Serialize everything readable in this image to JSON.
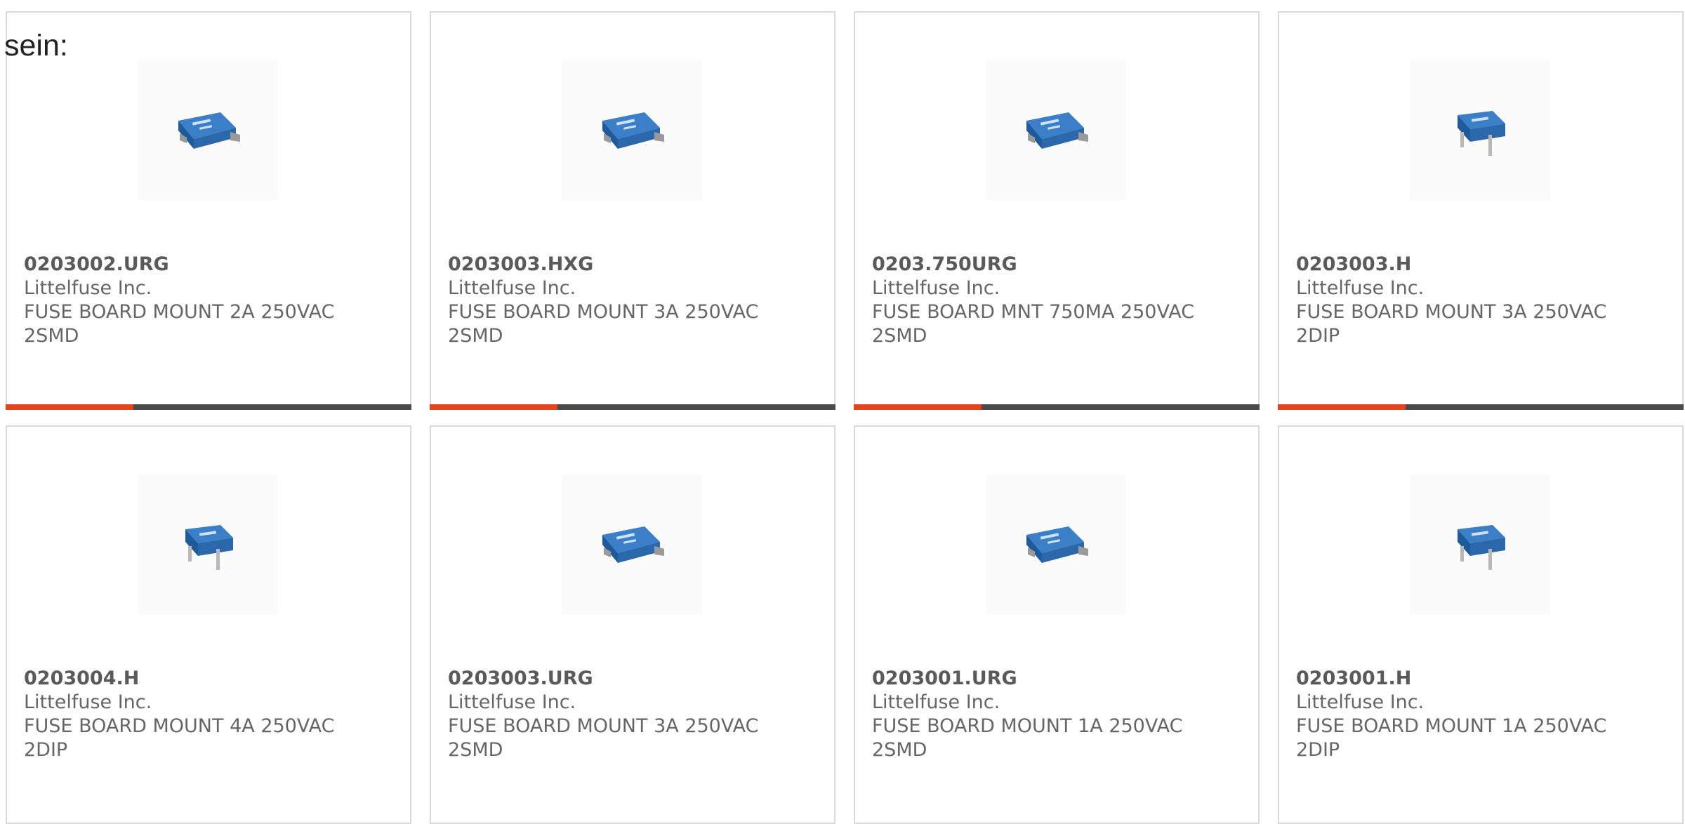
{
  "intro_text": "sein:",
  "colors": {
    "accent": "#e8441c",
    "bar_dark": "#4a4a4a",
    "border": "#dadada",
    "product_blue": "#2f6fb5"
  },
  "products": [
    {
      "part_number": "0203002.URG",
      "manufacturer": "Littelfuse Inc.",
      "description": "FUSE BOARD MOUNT 2A 250VAC 2SMD",
      "image_icon": "fuse-smd-icon"
    },
    {
      "part_number": "0203003.HXG",
      "manufacturer": "Littelfuse Inc.",
      "description": "FUSE BOARD MOUNT 3A 250VAC 2SMD",
      "image_icon": "fuse-smd-icon"
    },
    {
      "part_number": "0203.750URG",
      "manufacturer": "Littelfuse Inc.",
      "description": "FUSE BOARD MNT 750MA 250VAC 2SMD",
      "image_icon": "fuse-smd-icon"
    },
    {
      "part_number": "0203003.H",
      "manufacturer": "Littelfuse Inc.",
      "description": "FUSE BOARD MOUNT 3A 250VAC 2DIP",
      "image_icon": "fuse-dip-icon"
    },
    {
      "part_number": "0203004.H",
      "manufacturer": "Littelfuse Inc.",
      "description": "FUSE BOARD MOUNT 4A 250VAC 2DIP",
      "image_icon": "fuse-dip-icon"
    },
    {
      "part_number": "0203003.URG",
      "manufacturer": "Littelfuse Inc.",
      "description": "FUSE BOARD MOUNT 3A 250VAC 2SMD",
      "image_icon": "fuse-smd-icon"
    },
    {
      "part_number": "0203001.URG",
      "manufacturer": "Littelfuse Inc.",
      "description": "FUSE BOARD MOUNT 1A 250VAC 2SMD",
      "image_icon": "fuse-smd-icon"
    },
    {
      "part_number": "0203001.H",
      "manufacturer": "Littelfuse Inc.",
      "description": "FUSE BOARD MOUNT 1A 250VAC 2DIP",
      "image_icon": "fuse-dip-icon"
    }
  ]
}
